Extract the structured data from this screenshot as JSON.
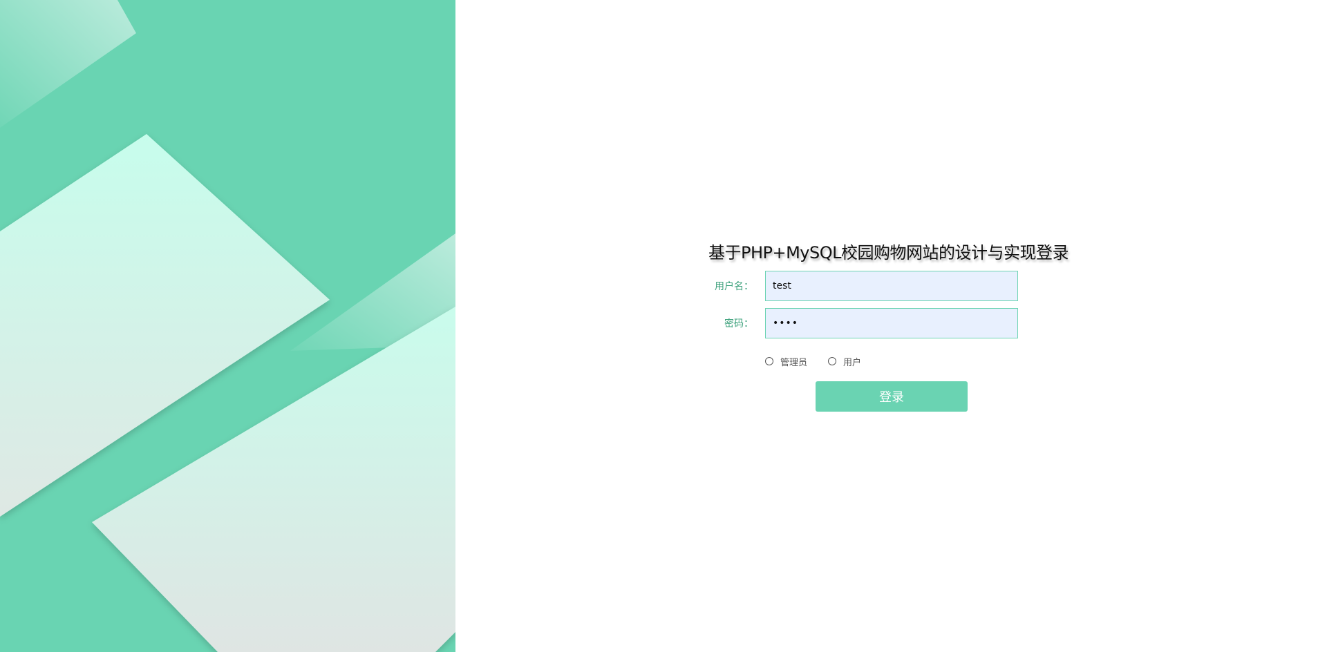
{
  "app": {
    "title": "基于PHP+MySQL校园购物网站的设计与实现登录"
  },
  "form": {
    "username_label": "用户名：",
    "username_value": "test",
    "password_label": "密码：",
    "password_value": "••••",
    "roles": [
      {
        "label": "管理员",
        "selected": false
      },
      {
        "label": "用户",
        "selected": false
      }
    ],
    "login_label": "登录"
  },
  "colors": {
    "accent": "#6ad3b2",
    "label": "#3aa07a",
    "input_bg": "#e8f0fe",
    "left_bg": "#69d4b2",
    "shape_light": "#c8fbec"
  },
  "icons": {
    "radio_admin": "radio-button-icon",
    "radio_user": "radio-button-icon"
  }
}
